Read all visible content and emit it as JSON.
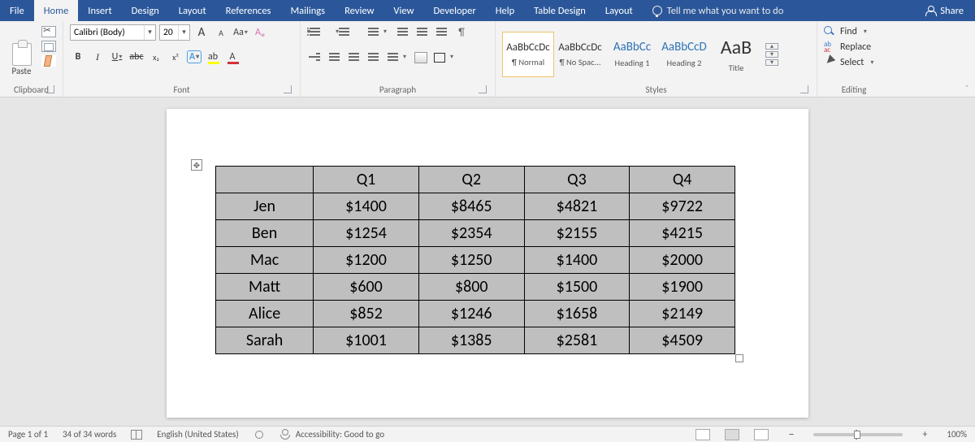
{
  "tabs": {
    "file": "File",
    "items": [
      "Home",
      "Insert",
      "Design",
      "Layout",
      "References",
      "Mailings",
      "Review",
      "View",
      "Developer",
      "Help",
      "Table Design",
      "Layout"
    ],
    "active": "Home",
    "tell_me": "Tell me what you want to do",
    "share": "Share"
  },
  "ribbon": {
    "clipboard": {
      "label": "Clipboard",
      "paste": "Paste"
    },
    "font": {
      "label": "Font",
      "name": "Calibri (Body)",
      "size": "20",
      "grow": "A",
      "shrink": "A",
      "case": "Aa",
      "bold": "B",
      "italic": "I",
      "underline": "U",
      "strike": "abc",
      "sub": "x",
      "sup": "x",
      "effects": "A",
      "hilite": "ab",
      "color": "A"
    },
    "paragraph": {
      "label": "Paragraph",
      "pilcrow": "¶"
    },
    "styles": {
      "label": "Styles",
      "items": [
        {
          "sample": "AaBbCcDc",
          "cap": "¶ Normal"
        },
        {
          "sample": "AaBbCcDc",
          "cap": "¶ No Spac..."
        },
        {
          "sample": "AaBbCc",
          "cap": "Heading 1"
        },
        {
          "sample": "AaBbCcD",
          "cap": "Heading 2"
        },
        {
          "sample": "AaB",
          "cap": "Title"
        }
      ]
    },
    "editing": {
      "label": "Editing",
      "find": "Find",
      "replace": "Replace",
      "select": "Select"
    }
  },
  "chart_data": {
    "type": "table",
    "columns": [
      "",
      "Q1",
      "Q2",
      "Q3",
      "Q4"
    ],
    "rows": [
      [
        "Jen",
        "$1400",
        "$8465",
        "$4821",
        "$9722"
      ],
      [
        "Ben",
        "$1254",
        "$2354",
        "$2155",
        "$4215"
      ],
      [
        "Mac",
        "$1200",
        "$1250",
        "$1400",
        "$2000"
      ],
      [
        "Matt",
        "$600",
        "$800",
        "$1500",
        "$1900"
      ],
      [
        "Alice",
        "$852",
        "$1246",
        "$1658",
        "$2149"
      ],
      [
        "Sarah",
        "$1001",
        "$1385",
        "$2581",
        "$4509"
      ]
    ]
  },
  "status": {
    "page": "Page 1 of 1",
    "words": "34 of 34 words",
    "lang": "English (United States)",
    "acc": "Accessibility: Good to go",
    "zoom": "100%"
  }
}
